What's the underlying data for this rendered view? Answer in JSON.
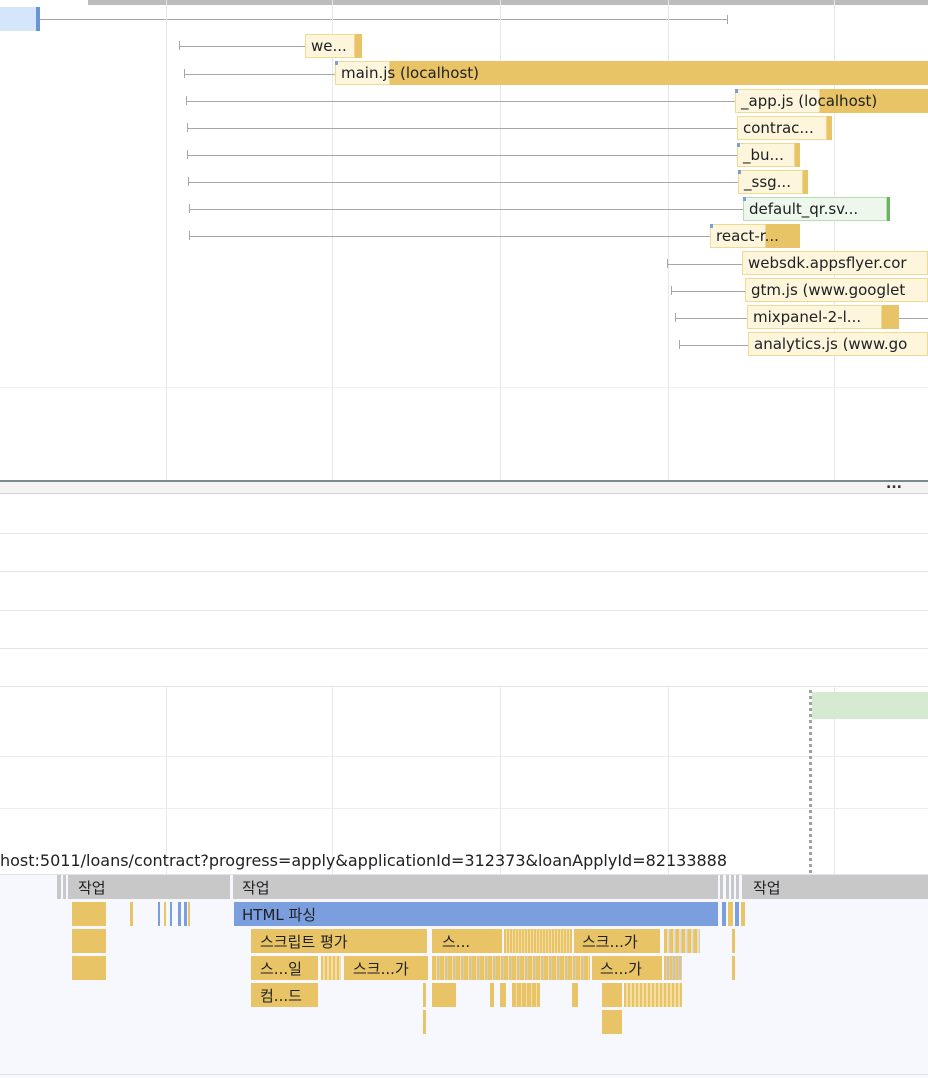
{
  "network": {
    "requests": [
      {
        "name": "we...",
        "label": "we..."
      },
      {
        "name": "main.js (localhost)",
        "label": "main.js (localhost)"
      },
      {
        "name": "_app.js (localhost)",
        "label": "_app.js (localhost)"
      },
      {
        "name": "contrac...",
        "label": "contrac..."
      },
      {
        "name": "_bu...",
        "label": "_bu..."
      },
      {
        "name": "_ssg...",
        "label": "_ssg..."
      },
      {
        "name": "default_qr.sv...",
        "label": "default_qr.sv..."
      },
      {
        "name": "react-r...",
        "label": "react-r..."
      },
      {
        "name": "websdk.appsflyer.com",
        "label": "websdk.appsflyer.cor"
      },
      {
        "name": "gtm.js (www.googletagmanager.com)",
        "label": "gtm.js (www.googlet"
      },
      {
        "name": "mixpanel-2-l...",
        "label": "mixpanel-2-l..."
      },
      {
        "name": "analytics.js (www.google-analytics.com)",
        "label": "analytics.js (www.go"
      }
    ],
    "more_button": "..."
  },
  "main_thread": {
    "url": "host:5011/loans/contract?progress=apply&applicationId=312373&loanApplyId=82133888",
    "tasks": [
      {
        "label": "작업"
      },
      {
        "label": "작업"
      },
      {
        "label": "작업"
      }
    ],
    "flame": {
      "html_parse": "HTML 파싱",
      "script_eval": "스크립트 평가",
      "s1": "스...",
      "s2": "스크...가",
      "s3": "스...일",
      "s4": "스크...가",
      "s5": "스...가",
      "compile": "컴...드"
    }
  },
  "colors": {
    "script": "#e9c466",
    "script_light": "#fdf5dc",
    "parse": "#7b9fde",
    "image": "#d6ead2",
    "task": "#c8c8c8",
    "selection": "#d5e6fa"
  }
}
